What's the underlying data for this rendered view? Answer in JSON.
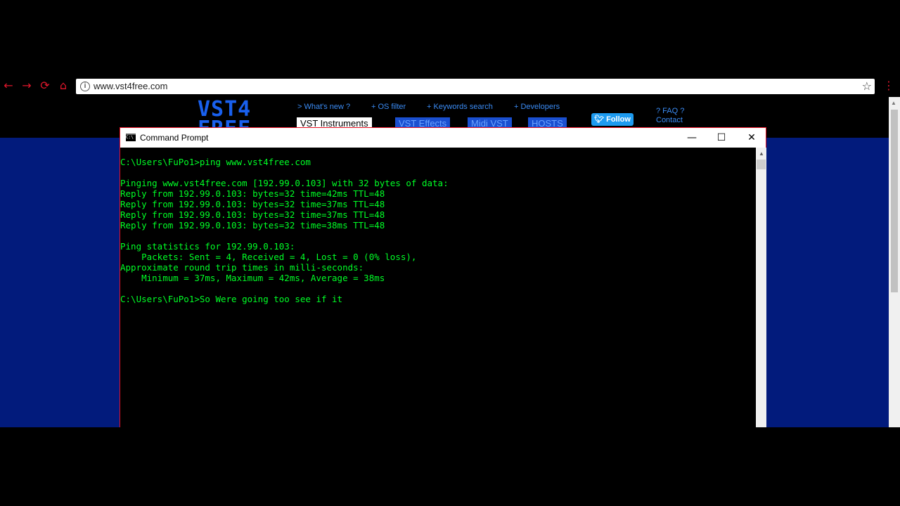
{
  "browser": {
    "url": "www.vst4free.com",
    "nav": {
      "back": "←",
      "forward": "→",
      "reload": "⟳",
      "home": "⌂"
    },
    "star_icon": "☆",
    "menu_icon": "⋮",
    "accent_color": "#e0162b"
  },
  "site": {
    "logo_line1": "VST4",
    "logo_line2": "FREE",
    "top_links": [
      "> What's new ?",
      "+ OS filter",
      "+ Keywords search",
      "+ Developers"
    ],
    "tabs": [
      "VST Instruments",
      "VST Effects",
      "Midi VST",
      "HOSTS"
    ],
    "follow_label": "Follow",
    "side_links": [
      "? FAQ ?",
      "Contact"
    ],
    "background_color": "#021b7c"
  },
  "cmd": {
    "title": "Command Prompt",
    "buttons": {
      "minimize": "—",
      "maximize": "☐",
      "close": "✕"
    },
    "lines": [
      "C:\\Users\\FuPo1>ping www.vst4free.com",
      "",
      "Pinging www.vst4free.com [192.99.0.103] with 32 bytes of data:",
      "Reply from 192.99.0.103: bytes=32 time=42ms TTL=48",
      "Reply from 192.99.0.103: bytes=32 time=37ms TTL=48",
      "Reply from 192.99.0.103: bytes=32 time=37ms TTL=48",
      "Reply from 192.99.0.103: bytes=32 time=38ms TTL=48",
      "",
      "Ping statistics for 192.99.0.103:",
      "    Packets: Sent = 4, Received = 4, Lost = 0 (0% loss),",
      "Approximate round trip times in milli-seconds:",
      "    Minimum = 37ms, Maximum = 42ms, Average = 38ms",
      "",
      "C:\\Users\\FuPo1>So Were going too see if it"
    ],
    "text_color": "#00ff26"
  }
}
